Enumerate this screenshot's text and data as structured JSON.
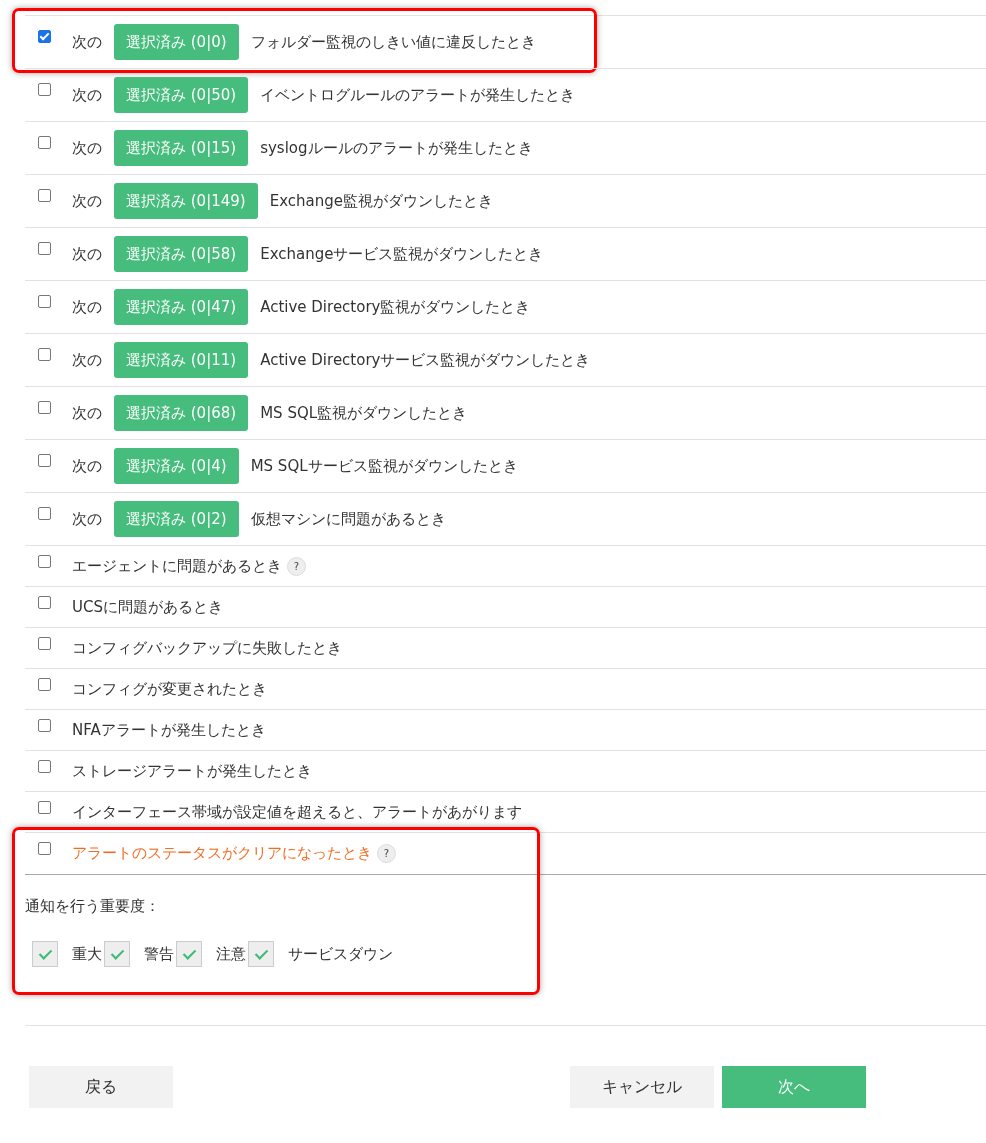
{
  "rules": [
    {
      "kind": "selector",
      "checked": true,
      "highlighted": true,
      "prefix": "次の",
      "button": "選択済み (0|0)",
      "text": "フォルダー監視のしきい値に違反したとき"
    },
    {
      "kind": "selector",
      "checked": false,
      "highlighted": false,
      "prefix": "次の",
      "button": "選択済み (0|50)",
      "text": "イベントログルールのアラートが発生したとき"
    },
    {
      "kind": "selector",
      "checked": false,
      "highlighted": false,
      "prefix": "次の",
      "button": "選択済み (0|15)",
      "text": "syslogルールのアラートが発生したとき"
    },
    {
      "kind": "selector",
      "checked": false,
      "highlighted": false,
      "prefix": "次の",
      "button": "選択済み (0|149)",
      "text": "Exchange監視がダウンしたとき"
    },
    {
      "kind": "selector",
      "checked": false,
      "highlighted": false,
      "prefix": "次の",
      "button": "選択済み (0|58)",
      "text": "Exchangeサービス監視がダウンしたとき"
    },
    {
      "kind": "selector",
      "checked": false,
      "highlighted": false,
      "prefix": "次の",
      "button": "選択済み (0|47)",
      "text": "Active Directory監視がダウンしたとき"
    },
    {
      "kind": "selector",
      "checked": false,
      "highlighted": false,
      "prefix": "次の",
      "button": "選択済み (0|11)",
      "text": "Active Directoryサービス監視がダウンしたとき"
    },
    {
      "kind": "selector",
      "checked": false,
      "highlighted": false,
      "prefix": "次の",
      "button": "選択済み (0|68)",
      "text": "MS SQL監視がダウンしたとき"
    },
    {
      "kind": "selector",
      "checked": false,
      "highlighted": false,
      "prefix": "次の",
      "button": "選択済み (0|4)",
      "text": "MS SQLサービス監視がダウンしたとき"
    },
    {
      "kind": "selector",
      "checked": false,
      "highlighted": false,
      "prefix": "次の",
      "button": "選択済み (0|2)",
      "text": "仮想マシンに問題があるとき"
    },
    {
      "kind": "plain",
      "checked": false,
      "highlighted": false,
      "text": "エージェントに問題があるとき",
      "help": "?"
    },
    {
      "kind": "plain",
      "checked": false,
      "highlighted": false,
      "text": "UCSに問題があるとき"
    },
    {
      "kind": "plain",
      "checked": false,
      "highlighted": false,
      "text": "コンフィグバックアップに失敗したとき"
    },
    {
      "kind": "plain",
      "checked": false,
      "highlighted": false,
      "text": "コンフィグが変更されたとき"
    },
    {
      "kind": "plain",
      "checked": false,
      "highlighted": false,
      "text": "NFAアラートが発生したとき"
    },
    {
      "kind": "plain",
      "checked": false,
      "highlighted": false,
      "text": "ストレージアラートが発生したとき"
    },
    {
      "kind": "plain",
      "checked": false,
      "highlighted": false,
      "text": "インターフェース帯域が設定値を超えると、アラートがあがります"
    }
  ],
  "clear_section": {
    "highlighted": true,
    "rule": {
      "checked": false,
      "text": "アラートのステータスがクリアになったとき",
      "help": "?"
    },
    "severity_label": "通知を行う重要度：",
    "levels": [
      {
        "label": "重大",
        "checked": true
      },
      {
        "label": "警告",
        "checked": true
      },
      {
        "label": "注意",
        "checked": true
      },
      {
        "label": "サービスダウン",
        "checked": true
      }
    ]
  },
  "buttons": {
    "back": "戻る",
    "cancel": "キャンセル",
    "next": "次へ"
  }
}
